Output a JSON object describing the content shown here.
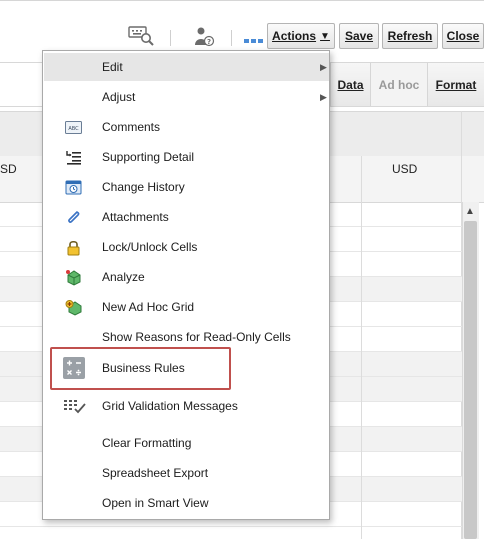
{
  "toolbar": {
    "icons": [
      "keyboard-search-icon",
      "user-question-icon",
      "dotted-line-icon"
    ],
    "actions_label": "Actions",
    "save_label": "Save",
    "refresh_label": "Refresh",
    "close_label": "Close"
  },
  "tabs": [
    {
      "label": "Data",
      "enabled": true
    },
    {
      "label": "Ad hoc",
      "enabled": false
    },
    {
      "label": "Format",
      "enabled": true
    }
  ],
  "grid": {
    "header_left": "SD",
    "header_right": "USD"
  },
  "menu": {
    "items": [
      {
        "label": "Edit",
        "icon": "none",
        "submenu": true,
        "highlighted": true
      },
      {
        "label": "Adjust",
        "icon": "none",
        "submenu": true
      },
      {
        "label": "Comments",
        "icon": "comments-icon"
      },
      {
        "label": "Supporting Detail",
        "icon": "supporting-detail-icon"
      },
      {
        "label": "Change History",
        "icon": "change-history-icon"
      },
      {
        "label": "Attachments",
        "icon": "paperclip-icon"
      },
      {
        "label": "Lock/Unlock Cells",
        "icon": "lock-icon"
      },
      {
        "label": "Analyze",
        "icon": "analyze-icon"
      },
      {
        "label": "New Ad Hoc Grid",
        "icon": "new-adhoc-grid-icon"
      },
      {
        "label": "Show Reasons for Read-Only Cells",
        "icon": "none"
      },
      {
        "label": "Business Rules",
        "icon": "calculator-icon",
        "outlined": true
      },
      {
        "label": "Grid Validation Messages",
        "icon": "grid-validation-icon"
      },
      {
        "label": "Clear Formatting",
        "icon": "none"
      },
      {
        "label": "Spreadsheet Export",
        "icon": "none"
      },
      {
        "label": "Open in Smart View",
        "icon": "none"
      }
    ]
  },
  "colors": {
    "outline": "#c0504d",
    "menu_highlight": "#e6e6e6",
    "tab_disabled_text": "#9a9a9a"
  }
}
